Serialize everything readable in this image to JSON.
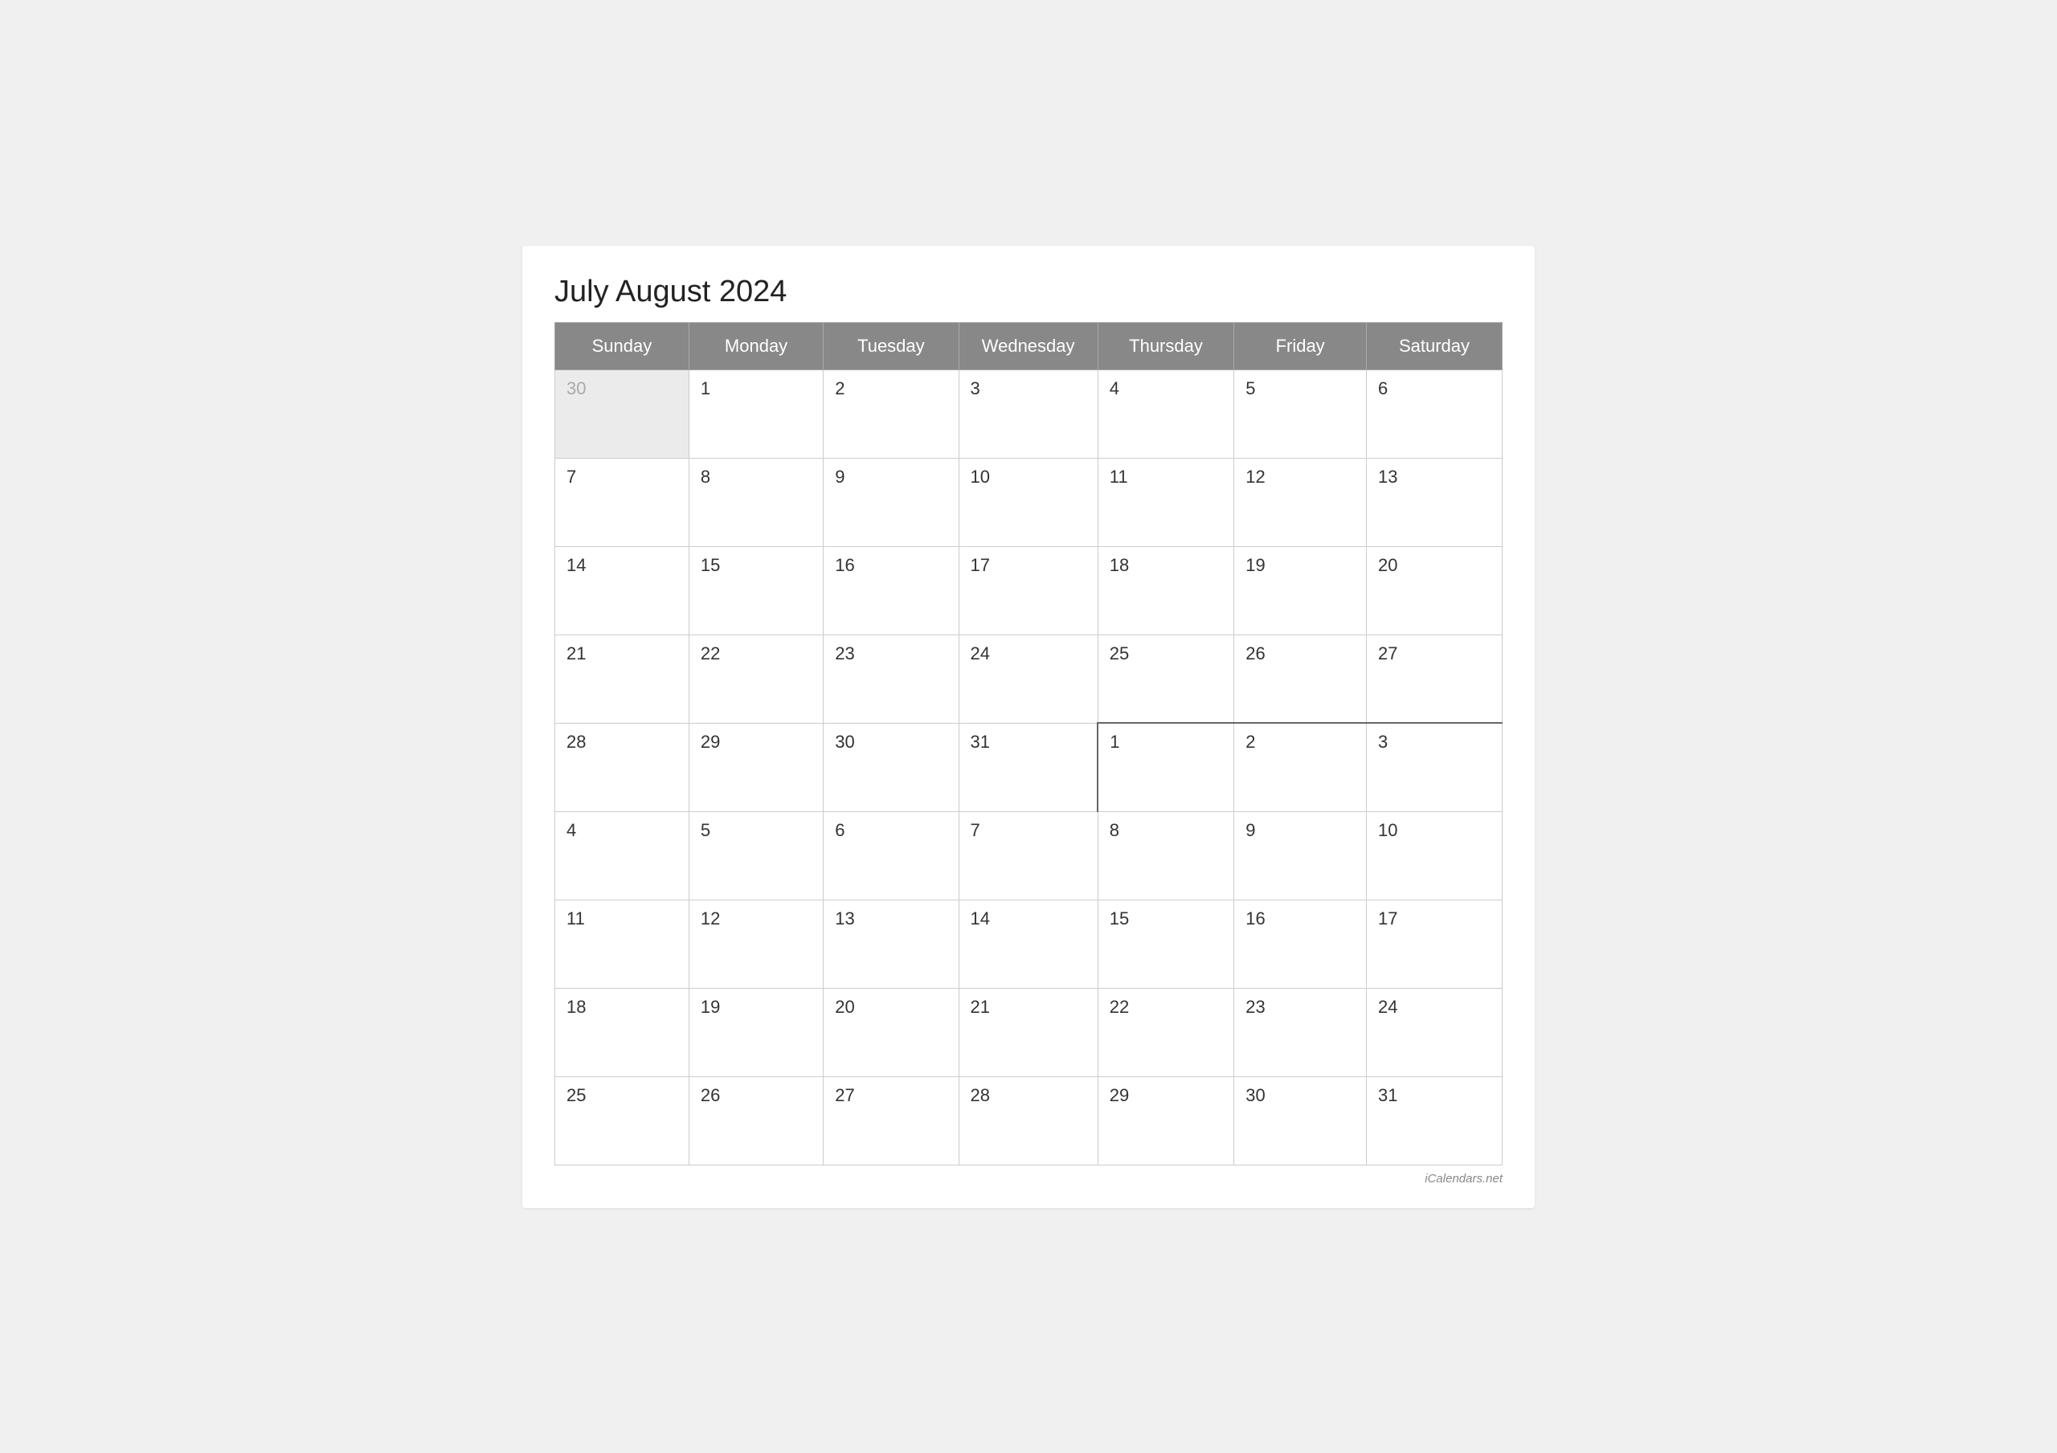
{
  "title": "July August 2024",
  "watermark": "iCalendars.net",
  "headers": [
    "Sunday",
    "Monday",
    "Tuesday",
    "Wednesday",
    "Thursday",
    "Friday",
    "Saturday"
  ],
  "weeks": [
    [
      {
        "day": "30",
        "type": "prev-month"
      },
      {
        "day": "1",
        "type": "current"
      },
      {
        "day": "2",
        "type": "current"
      },
      {
        "day": "3",
        "type": "current"
      },
      {
        "day": "4",
        "type": "current"
      },
      {
        "day": "5",
        "type": "current"
      },
      {
        "day": "6",
        "type": "current"
      }
    ],
    [
      {
        "day": "7",
        "type": "current"
      },
      {
        "day": "8",
        "type": "current"
      },
      {
        "day": "9",
        "type": "current"
      },
      {
        "day": "10",
        "type": "current"
      },
      {
        "day": "11",
        "type": "current"
      },
      {
        "day": "12",
        "type": "current"
      },
      {
        "day": "13",
        "type": "current"
      }
    ],
    [
      {
        "day": "14",
        "type": "current"
      },
      {
        "day": "15",
        "type": "current"
      },
      {
        "day": "16",
        "type": "current"
      },
      {
        "day": "17",
        "type": "current"
      },
      {
        "day": "18",
        "type": "current"
      },
      {
        "day": "19",
        "type": "current"
      },
      {
        "day": "20",
        "type": "current"
      }
    ],
    [
      {
        "day": "21",
        "type": "current"
      },
      {
        "day": "22",
        "type": "current"
      },
      {
        "day": "23",
        "type": "current"
      },
      {
        "day": "24",
        "type": "current"
      },
      {
        "day": "25",
        "type": "current"
      },
      {
        "day": "26",
        "type": "current"
      },
      {
        "day": "27",
        "type": "current"
      }
    ],
    [
      {
        "day": "28",
        "type": "current"
      },
      {
        "day": "29",
        "type": "current"
      },
      {
        "day": "30",
        "type": "current"
      },
      {
        "day": "31",
        "type": "current"
      },
      {
        "day": "1",
        "type": "next-month boundary-top"
      },
      {
        "day": "2",
        "type": "next-month boundary-top"
      },
      {
        "day": "3",
        "type": "next-month boundary-top"
      }
    ],
    [
      {
        "day": "4",
        "type": "current2"
      },
      {
        "day": "5",
        "type": "current2"
      },
      {
        "day": "6",
        "type": "current2"
      },
      {
        "day": "7",
        "type": "current2"
      },
      {
        "day": "8",
        "type": "current2"
      },
      {
        "day": "9",
        "type": "current2"
      },
      {
        "day": "10",
        "type": "current2"
      }
    ],
    [
      {
        "day": "11",
        "type": "current2"
      },
      {
        "day": "12",
        "type": "current2"
      },
      {
        "day": "13",
        "type": "current2"
      },
      {
        "day": "14",
        "type": "current2"
      },
      {
        "day": "15",
        "type": "current2"
      },
      {
        "day": "16",
        "type": "current2"
      },
      {
        "day": "17",
        "type": "current2"
      }
    ],
    [
      {
        "day": "18",
        "type": "current2"
      },
      {
        "day": "19",
        "type": "current2"
      },
      {
        "day": "20",
        "type": "current2"
      },
      {
        "day": "21",
        "type": "current2"
      },
      {
        "day": "22",
        "type": "current2"
      },
      {
        "day": "23",
        "type": "current2"
      },
      {
        "day": "24",
        "type": "current2"
      }
    ],
    [
      {
        "day": "25",
        "type": "current2"
      },
      {
        "day": "26",
        "type": "current2"
      },
      {
        "day": "27",
        "type": "current2"
      },
      {
        "day": "28",
        "type": "current2"
      },
      {
        "day": "29",
        "type": "current2"
      },
      {
        "day": "30",
        "type": "current2"
      },
      {
        "day": "31",
        "type": "current2"
      }
    ]
  ]
}
